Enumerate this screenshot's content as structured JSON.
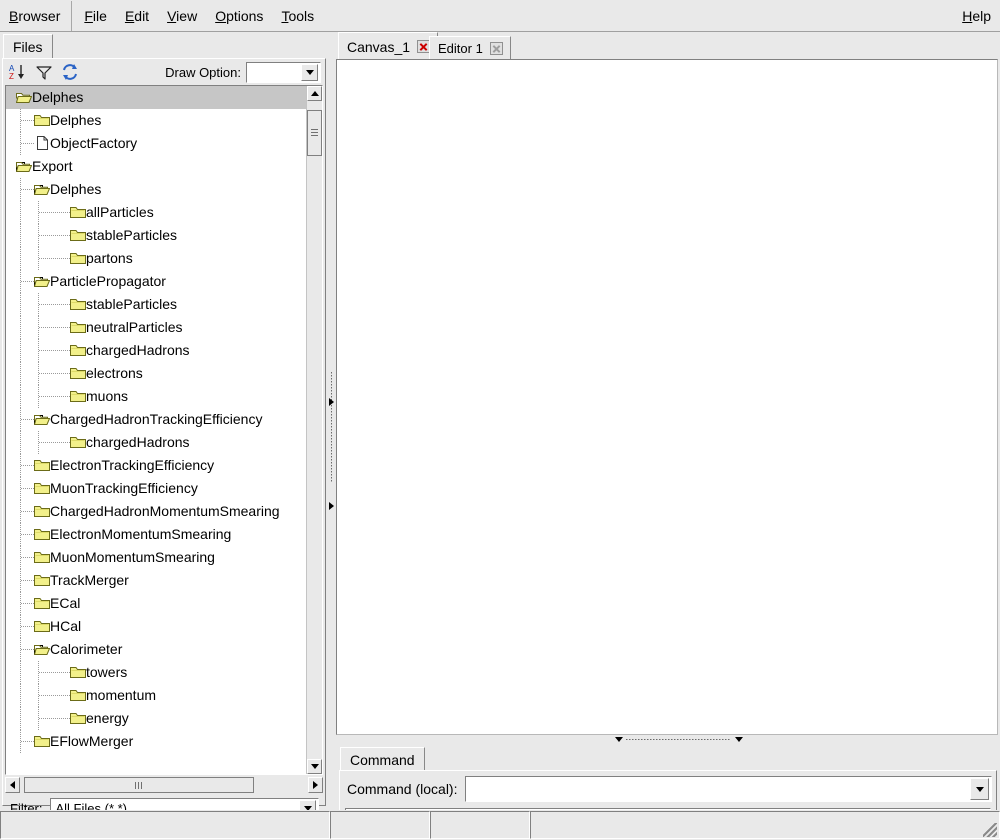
{
  "menubar": {
    "app_label": "Browser",
    "items": [
      {
        "label": "File",
        "mnemonic": "F"
      },
      {
        "label": "Edit",
        "mnemonic": "E"
      },
      {
        "label": "View",
        "mnemonic": "V"
      },
      {
        "label": "Options",
        "mnemonic": "O"
      },
      {
        "label": "Tools",
        "mnemonic": "T"
      }
    ],
    "help_label": "Help"
  },
  "left_pane": {
    "tab_label": "Files",
    "toolbar": {
      "sort_icon": "sort-az-icon",
      "filter_icon": "filter-funnel-icon",
      "refresh_icon": "refresh-icon",
      "draw_option_label": "Draw Option:",
      "draw_option_value": ""
    },
    "filter": {
      "label": "Filter:",
      "value": "All Files (*.*)"
    },
    "tree": [
      {
        "label": "Delphes",
        "depth": 0,
        "icon": "folder-open",
        "expander": "none",
        "selected": true
      },
      {
        "label": "Delphes",
        "depth": 1,
        "icon": "folder-closed",
        "expander": "none",
        "selected": false
      },
      {
        "label": "ObjectFactory",
        "depth": 1,
        "icon": "document",
        "expander": "none",
        "selected": false
      },
      {
        "label": "Export",
        "depth": 0,
        "icon": "folder-open",
        "expander": "minus",
        "selected": false
      },
      {
        "label": "Delphes",
        "depth": 1,
        "icon": "folder-open",
        "expander": "minus",
        "selected": false
      },
      {
        "label": "allParticles",
        "depth": 2,
        "icon": "folder-closed",
        "expander": "none",
        "selected": false
      },
      {
        "label": "stableParticles",
        "depth": 2,
        "icon": "folder-closed",
        "expander": "none",
        "selected": false
      },
      {
        "label": "partons",
        "depth": 2,
        "icon": "folder-closed",
        "expander": "none",
        "selected": false
      },
      {
        "label": "ParticlePropagator",
        "depth": 1,
        "icon": "folder-open",
        "expander": "minus",
        "selected": false
      },
      {
        "label": "stableParticles",
        "depth": 2,
        "icon": "folder-closed",
        "expander": "none",
        "selected": false
      },
      {
        "label": "neutralParticles",
        "depth": 2,
        "icon": "folder-closed",
        "expander": "none",
        "selected": false
      },
      {
        "label": "chargedHadrons",
        "depth": 2,
        "icon": "folder-closed",
        "expander": "none",
        "selected": false
      },
      {
        "label": "electrons",
        "depth": 2,
        "icon": "folder-closed",
        "expander": "none",
        "selected": false
      },
      {
        "label": "muons",
        "depth": 2,
        "icon": "folder-closed",
        "expander": "none",
        "selected": false
      },
      {
        "label": "ChargedHadronTrackingEfficiency",
        "depth": 1,
        "icon": "folder-open",
        "expander": "minus",
        "selected": false
      },
      {
        "label": "chargedHadrons",
        "depth": 2,
        "icon": "folder-closed",
        "expander": "none",
        "selected": false
      },
      {
        "label": "ElectronTrackingEfficiency",
        "depth": 1,
        "icon": "folder-closed",
        "expander": "none",
        "selected": false
      },
      {
        "label": "MuonTrackingEfficiency",
        "depth": 1,
        "icon": "folder-closed",
        "expander": "none",
        "selected": false
      },
      {
        "label": "ChargedHadronMomentumSmearing",
        "depth": 1,
        "icon": "folder-closed",
        "expander": "none",
        "selected": false
      },
      {
        "label": "ElectronMomentumSmearing",
        "depth": 1,
        "icon": "folder-closed",
        "expander": "none",
        "selected": false
      },
      {
        "label": "MuonMomentumSmearing",
        "depth": 1,
        "icon": "folder-closed",
        "expander": "none",
        "selected": false
      },
      {
        "label": "TrackMerger",
        "depth": 1,
        "icon": "folder-closed",
        "expander": "none",
        "selected": false
      },
      {
        "label": "ECal",
        "depth": 1,
        "icon": "folder-closed",
        "expander": "none",
        "selected": false
      },
      {
        "label": "HCal",
        "depth": 1,
        "icon": "folder-closed",
        "expander": "none",
        "selected": false
      },
      {
        "label": "Calorimeter",
        "depth": 1,
        "icon": "folder-open",
        "expander": "minus",
        "selected": false
      },
      {
        "label": "towers",
        "depth": 2,
        "icon": "folder-closed",
        "expander": "none",
        "selected": false
      },
      {
        "label": "momentum",
        "depth": 2,
        "icon": "folder-closed",
        "expander": "none",
        "selected": false
      },
      {
        "label": "energy",
        "depth": 2,
        "icon": "folder-closed",
        "expander": "none",
        "selected": false
      },
      {
        "label": "EFlowMerger",
        "depth": 1,
        "icon": "folder-closed",
        "expander": "none",
        "selected": false
      }
    ]
  },
  "right_pane": {
    "tabs": [
      {
        "label": "Canvas_1",
        "active": true,
        "close_icon": "close-icon-red"
      },
      {
        "label": "Editor 1",
        "active": false,
        "close_icon": "close-icon-gray"
      }
    ],
    "command": {
      "tab_label": "Command",
      "prompt_label": "Command (local):",
      "input_value": "",
      "status_value": ""
    }
  },
  "statusbar": {
    "segments": [
      "",
      "",
      "",
      ""
    ]
  },
  "colors": {
    "window_bg": "#e9e9e9",
    "canvas_bg": "#ffffff",
    "selection_bg": "#c6c6c6",
    "folder_yellow": "#f2f08a",
    "folder_border": "#8a8a20",
    "close_red": "#cc0000",
    "close_gray": "#9e9e9e"
  }
}
